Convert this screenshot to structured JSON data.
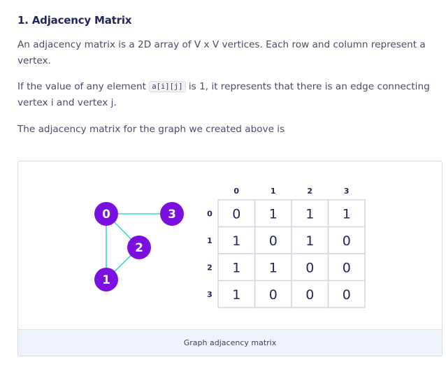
{
  "section": {
    "title": "1. Adjacency Matrix",
    "paragraph1": "An adjacency matrix is a 2D array of V x V vertices. Each row and column represent a vertex.",
    "paragraph2_before": "If the value of any element ",
    "paragraph2_code": "a[i][j]",
    "paragraph2_after": " is 1, it represents that there is an edge connecting vertex i and vertex j.",
    "paragraph3": "The adjacency matrix for the graph we created above is"
  },
  "figure": {
    "caption": "Graph adjacency matrix",
    "node_color": "#7b0fe0",
    "edge_color": "#3dd6c9",
    "graph": {
      "nodes": [
        "0",
        "1",
        "2",
        "3"
      ],
      "edges": [
        [
          "0",
          "3"
        ],
        [
          "0",
          "2"
        ],
        [
          "0",
          "1"
        ],
        [
          "1",
          "2"
        ]
      ]
    },
    "matrix": {
      "column_headers": [
        "0",
        "1",
        "2",
        "3"
      ],
      "row_headers": [
        "0",
        "1",
        "2",
        "3"
      ],
      "rows": [
        [
          "0",
          "1",
          "1",
          "1"
        ],
        [
          "1",
          "0",
          "1",
          "0"
        ],
        [
          "1",
          "1",
          "0",
          "0"
        ],
        [
          "1",
          "0",
          "0",
          "0"
        ]
      ]
    }
  }
}
